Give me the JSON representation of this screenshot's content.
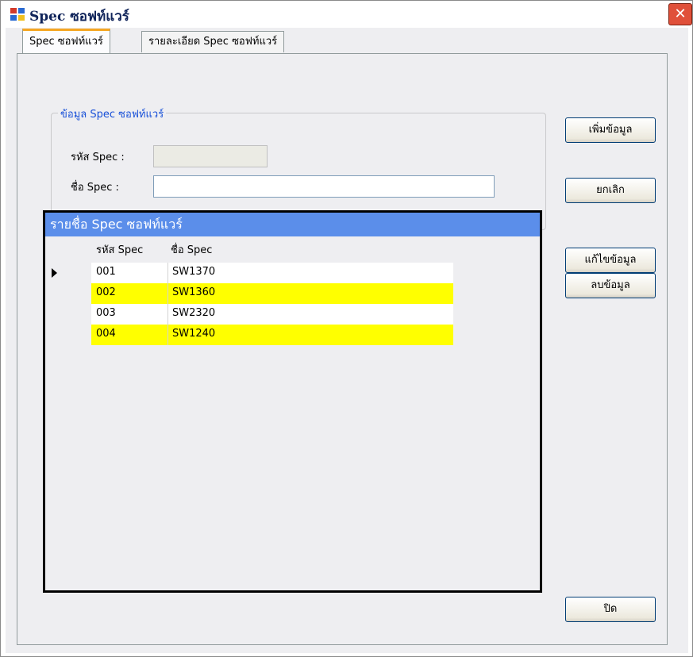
{
  "window": {
    "title": "Spec ซอฟท์แวร์",
    "close_glyph": "✕"
  },
  "tabs": [
    {
      "label": "Spec ซอฟท์แวร์",
      "active": true
    },
    {
      "label": "รายละเอียด Spec ซอฟท์แวร์",
      "active": false
    }
  ],
  "group": {
    "legend": "ข้อมูล Spec ซอฟท์แวร์",
    "code_label": "รหัส Spec :",
    "code_value": "",
    "name_label": "ชื่อ Spec :",
    "name_value": ""
  },
  "buttons": {
    "add": "เพิ่มข้อมูล",
    "cancel": "ยกเลิก",
    "edit": "แก้ไขข้อมูล",
    "delete": "ลบข้อมูล",
    "close": "ปิด"
  },
  "grid": {
    "caption": "รายชื่อ Spec ซอฟท์แวร์",
    "columns": [
      "รหัส Spec",
      "ชื่อ Spec"
    ],
    "rows": [
      {
        "code": "001",
        "name": "SW1370"
      },
      {
        "code": "002",
        "name": "SW1360"
      },
      {
        "code": "003",
        "name": "SW2320"
      },
      {
        "code": "004",
        "name": "SW1240"
      }
    ],
    "selected_row": 0
  },
  "colors": {
    "caption_bg": "#5b8eea",
    "alt_row_bg": "#ffff00",
    "tab_highlight": "#f5a623",
    "legend_text": "#1850d8"
  }
}
